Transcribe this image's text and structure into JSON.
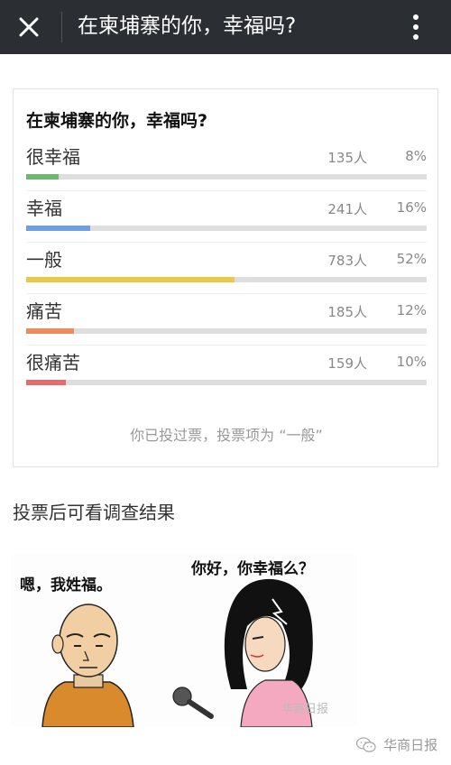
{
  "header": {
    "title": "在柬埔寨的你，幸福吗?"
  },
  "poll": {
    "question": "在柬埔寨的你，幸福吗?",
    "options": [
      {
        "label": "很幸福",
        "count": "135人",
        "percent": "8%",
        "fraction": 0.08,
        "color": "#6cb86c"
      },
      {
        "label": "幸福",
        "count": "241人",
        "percent": "16%",
        "fraction": 0.16,
        "color": "#6f9fe0"
      },
      {
        "label": "一般",
        "count": "783人",
        "percent": "52%",
        "fraction": 0.52,
        "color": "#ecc645"
      },
      {
        "label": "痛苦",
        "count": "185人",
        "percent": "12%",
        "fraction": 0.12,
        "color": "#ef8a5c"
      },
      {
        "label": "很痛苦",
        "count": "159人",
        "percent": "10%",
        "fraction": 0.1,
        "color": "#e86a6a"
      }
    ],
    "voted_text": "你已投过票，投票项为 “一般”"
  },
  "note": "投票后可看调查结果",
  "comic": {
    "left_bubble": "嗯，我姓福。",
    "right_bubble": "你好，你幸福么？",
    "stamp": "华商日报"
  },
  "watermark": {
    "text": "华商日报",
    "icon": "wechat-icon"
  }
}
